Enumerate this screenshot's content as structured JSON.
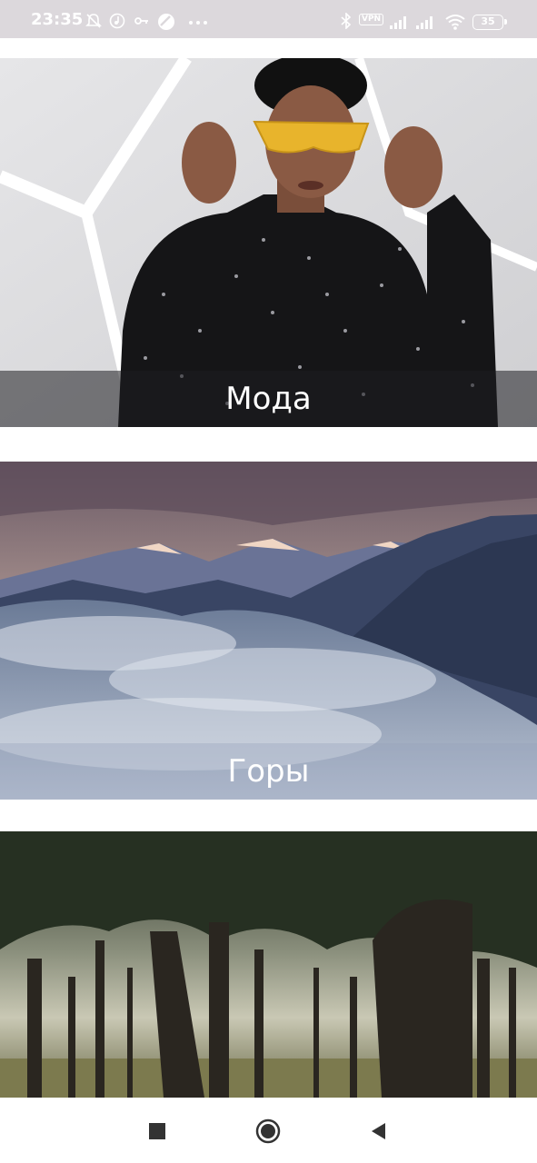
{
  "status_bar": {
    "time": "23:35",
    "vpn_label": "VPN",
    "battery_level": "35",
    "icons": [
      "bell-off-icon",
      "music-icon",
      "key-icon",
      "app-icon",
      "more-icon",
      "bluetooth-icon",
      "signal-icon",
      "signal-icon",
      "wifi-icon",
      "battery-icon"
    ]
  },
  "feed": {
    "cards": [
      {
        "label": "Мода",
        "image": "fashion-photo"
      },
      {
        "label": "Горы",
        "image": "mountains-photo"
      },
      {
        "label": "",
        "image": "forest-photo"
      }
    ]
  },
  "nav_bar": {
    "buttons": [
      "recents-square-icon",
      "home-circle-icon",
      "back-triangle-icon"
    ]
  },
  "colors": {
    "status_bar_bg": "#dcd8dc",
    "label_band": "#1e1e20",
    "background": "#ffffff"
  }
}
